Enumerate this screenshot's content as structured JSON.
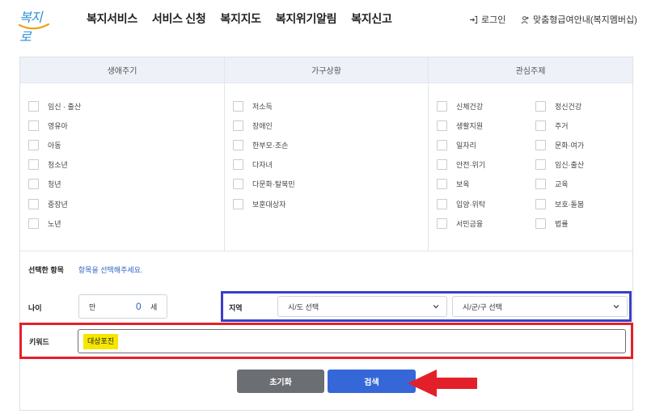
{
  "header": {
    "logo_text": "복지로",
    "nav": [
      "복지서비스",
      "서비스 신청",
      "복지지도",
      "복지위기알림",
      "복지신고"
    ],
    "login_label": "로그인",
    "member_label": "맞춤형급여안내(복지멤버십)"
  },
  "filters": {
    "columns": [
      {
        "title": "생애주기",
        "items": [
          "임신 · 출산",
          "영유아",
          "아동",
          "청소년",
          "청년",
          "중장년",
          "노년"
        ]
      },
      {
        "title": "가구상황",
        "items": [
          "저소득",
          "장애인",
          "한부모·조손",
          "다자녀",
          "다문화·탈북민",
          "보훈대상자"
        ]
      },
      {
        "title": "관심주제",
        "items_left": [
          "신체건강",
          "생활지원",
          "일자리",
          "안전·위기",
          "보육",
          "입양·위탁",
          "서민금융"
        ],
        "items_right": [
          "정신건강",
          "주거",
          "문화·여가",
          "임신·출산",
          "교육",
          "보호·돌봄",
          "법률"
        ]
      }
    ]
  },
  "selected": {
    "label": "선택한 항목",
    "placeholder": "항목을 선택해주세요."
  },
  "age": {
    "label": "나이",
    "from": "만",
    "value": "0",
    "unit": "세"
  },
  "region": {
    "label": "지역",
    "sido": "시/도 선택",
    "sigungu": "시/군/구 선택"
  },
  "keyword": {
    "label": "키워드",
    "value": "대상포진"
  },
  "buttons": {
    "reset": "초기화",
    "search": "검색"
  },
  "colors": {
    "accent": "#3567d8",
    "highlight_red": "#e3202a",
    "highlight_blue": "#3a3fc4",
    "marker": "#f7e600"
  }
}
